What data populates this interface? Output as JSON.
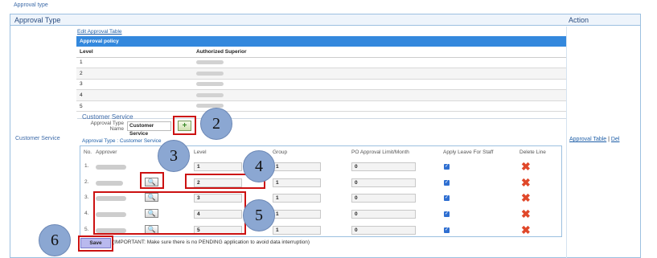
{
  "page": {
    "title": "Approval type"
  },
  "header": {
    "approval_type": "Approval Type",
    "action": "Action"
  },
  "row_label": "Customer Service",
  "edit_link": "Edit Approval Table",
  "policy_table": {
    "caption": "Approval policy",
    "col_level": "Level",
    "col_superior": "Authorized Superior",
    "levels": [
      "1",
      "2",
      "3",
      "4",
      "5"
    ]
  },
  "customer_service": {
    "section_title": "Customer Service",
    "approval_type_label_1": "Approval Type",
    "approval_type_label_2": "Name",
    "approval_type_value": "Customer Service",
    "add_icon": "+"
  },
  "breadcrumb": "Approval Type : Customer Service",
  "approver_table": {
    "headers": {
      "no": "No.",
      "approver": "Approver",
      "level": "Level",
      "group": "Group",
      "po_limit": "PO Approval Limit/Month",
      "apply_leave": "Apply Leave For Staff",
      "delete": "Delete Line"
    },
    "rows": [
      {
        "no": "1.",
        "level": "1",
        "group": "1",
        "po_limit": "0"
      },
      {
        "no": "2.",
        "level": "2",
        "group": "1",
        "po_limit": "0"
      },
      {
        "no": "3.",
        "level": "3",
        "group": "1",
        "po_limit": "0"
      },
      {
        "no": "4.",
        "level": "4",
        "group": "1",
        "po_limit": "0"
      },
      {
        "no": "5.",
        "level": "5",
        "group": "1",
        "po_limit": "0"
      }
    ],
    "lookup_icon": "🔍",
    "check_icon": "✓",
    "delete_icon": "✖"
  },
  "save_button": "Save",
  "important_note": "(IMPORTANT: Make sure there is no PENDING application to avoid data interruption)",
  "actions": {
    "approval_table": "Approval Table",
    "separator": "|",
    "delete": "Del"
  },
  "callouts": [
    "2",
    "3",
    "4",
    "5",
    "6"
  ],
  "colors": {
    "accent": "#3388dd",
    "annotation_red": "#cc1111",
    "callout": "#8ba7d2",
    "delete_red": "#e0482a"
  }
}
